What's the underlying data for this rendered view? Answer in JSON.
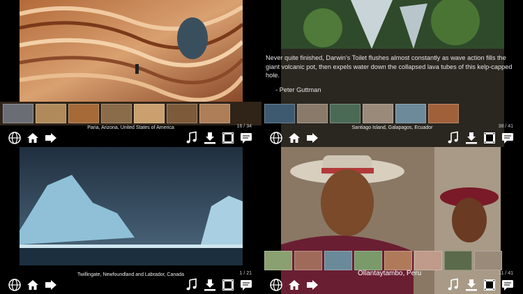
{
  "panels": [
    {
      "id": "p1",
      "photo_desc_icon": "sandstone-wave-photo",
      "caption": "Paria, Arizona, United States of America",
      "counter": "16 / 34",
      "thumb_colors": [
        "#6a6e74",
        "#b08a5a",
        "#a56a38",
        "#8a6b4a",
        "#c9a06e",
        "#7c5a3a",
        "#ad7e58"
      ]
    },
    {
      "id": "p2",
      "photo_desc_icon": "waterfall-photo",
      "caption": "Santiago Island, Galapagos, Ecuador",
      "counter": "38 / 41",
      "quote_text": "Never quite finished, Darwin's Toilet flushes almost constantly as wave action fills the giant volcanic pot, then expels water down the collapsed lava tubes of this kelp-capped hole.",
      "quote_attr": "- Peter Guttman",
      "thumb_colors": [
        "#3d5a70",
        "#8a7a6a",
        "#4b6a55",
        "#9a8a7a",
        "#6d8a9a",
        "#a0603a"
      ]
    },
    {
      "id": "p3",
      "photo_desc_icon": "iceberg-photo",
      "caption": "Twillingate, Newfoundland and Labrador, Canada",
      "counter": "1 / 21"
    },
    {
      "id": "p4",
      "photo_desc_icon": "peruvian-man-photo",
      "caption": "Ollantaytambo, Peru",
      "counter": "11 / 41",
      "thumb_colors": [
        "#8aa070",
        "#a06a5a",
        "#6a8a9a",
        "#7a9a6a",
        "#b07a5a",
        "#c09a8a",
        "#5a6a4a",
        "#9a8a7a"
      ]
    }
  ],
  "toolbar": {
    "left_icons": [
      "globe-icon",
      "home-icon",
      "forward-arrow-icon"
    ],
    "right_icons": [
      "music-note-icon",
      "download-icon",
      "film-icon",
      "chat-icon"
    ]
  }
}
